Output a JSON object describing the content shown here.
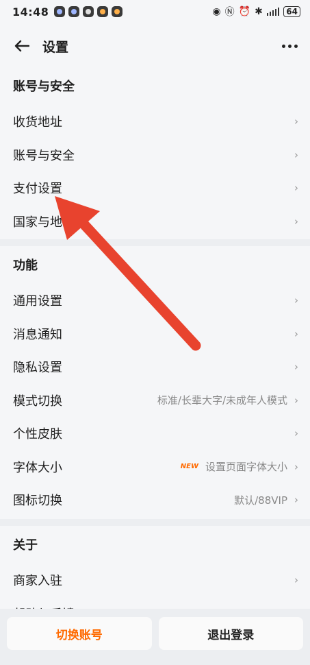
{
  "status_bar": {
    "time": "14:48",
    "battery": "64"
  },
  "header": {
    "title": "设置"
  },
  "sections": [
    {
      "title": "账号与安全",
      "items": [
        {
          "label": "收货地址",
          "value": ""
        },
        {
          "label": "账号与安全",
          "value": ""
        },
        {
          "label": "支付设置",
          "value": ""
        },
        {
          "label": "国家与地区",
          "value": ""
        }
      ]
    },
    {
      "title": "功能",
      "items": [
        {
          "label": "通用设置",
          "value": ""
        },
        {
          "label": "消息通知",
          "value": ""
        },
        {
          "label": "隐私设置",
          "value": ""
        },
        {
          "label": "模式切换",
          "value": "标准/长辈大字/未成年人模式"
        },
        {
          "label": "个性皮肤",
          "value": ""
        },
        {
          "label": "字体大小",
          "badge": "NEW",
          "value": "设置页面字体大小"
        },
        {
          "label": "图标切换",
          "value": "默认/88VIP"
        }
      ]
    },
    {
      "title": "关于",
      "items": [
        {
          "label": "商家入驻",
          "value": ""
        },
        {
          "label": "帮助与反馈",
          "value": ""
        }
      ]
    }
  ],
  "buttons": {
    "switch_account": "切换账号",
    "logout": "退出登录"
  },
  "colors": {
    "accent": "#ff6a00",
    "annotation_arrow": "#e8432e",
    "background": "#f5f6f8"
  }
}
